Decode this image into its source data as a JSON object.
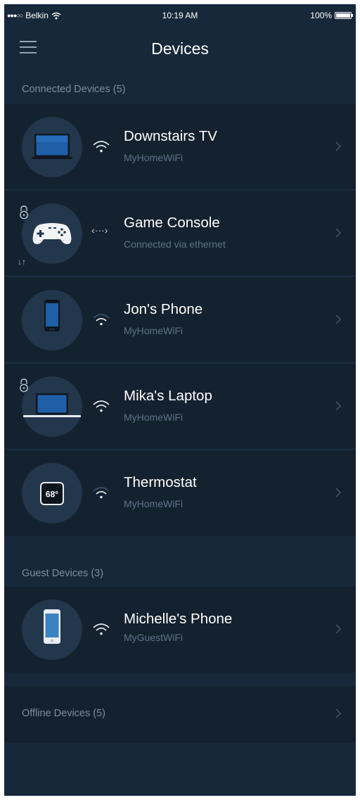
{
  "status_bar": {
    "carrier": "Belkin",
    "signal_dots": "●●●○○",
    "time": "10:19 AM",
    "battery_percent": "100%",
    "battery_level": 1.0
  },
  "nav": {
    "title": "Devices"
  },
  "sections": {
    "connected": {
      "label": "Connected Devices (5)"
    },
    "guest": {
      "label": "Guest Devices  (3)"
    },
    "offline": {
      "label": "Offline Devices  (5)"
    }
  },
  "devices": [
    {
      "name": "Downstairs TV",
      "sub": "MyHomeWiFi",
      "icon": "tv-icon",
      "connection": "wifi-icon",
      "signal": "strong",
      "locked": false
    },
    {
      "name": "Game Console",
      "sub": "Connected via ethernet",
      "icon": "game-controller-icon",
      "connection": "ethernet-icon",
      "connection_glyph": "‹···›",
      "locked": true,
      "transfer": "↓↑"
    },
    {
      "name": "Jon's Phone",
      "sub": "MyHomeWiFi",
      "icon": "phone-icon",
      "connection": "wifi-icon",
      "signal": "weak",
      "locked": false
    },
    {
      "name": "Mika's Laptop",
      "sub": "MyHomeWiFi",
      "icon": "laptop-icon",
      "connection": "wifi-icon",
      "signal": "strong",
      "locked": true
    },
    {
      "name": "Thermostat",
      "sub": "MyHomeWiFi",
      "icon": "thermostat-icon",
      "connection": "wifi-icon",
      "signal": "weak",
      "locked": false,
      "display": "68°"
    }
  ],
  "guest_devices": [
    {
      "name": "Michelle's Phone",
      "sub": "MyGuestWiFi",
      "icon": "phone-icon",
      "connection": "wifi-icon",
      "signal": "strong",
      "locked": false
    }
  ],
  "colors": {
    "background": "#17283a",
    "row_background": "#14222f",
    "avatar": "#23374c",
    "muted_text": "#7d8d9f",
    "sub_text": "#5f7286"
  }
}
